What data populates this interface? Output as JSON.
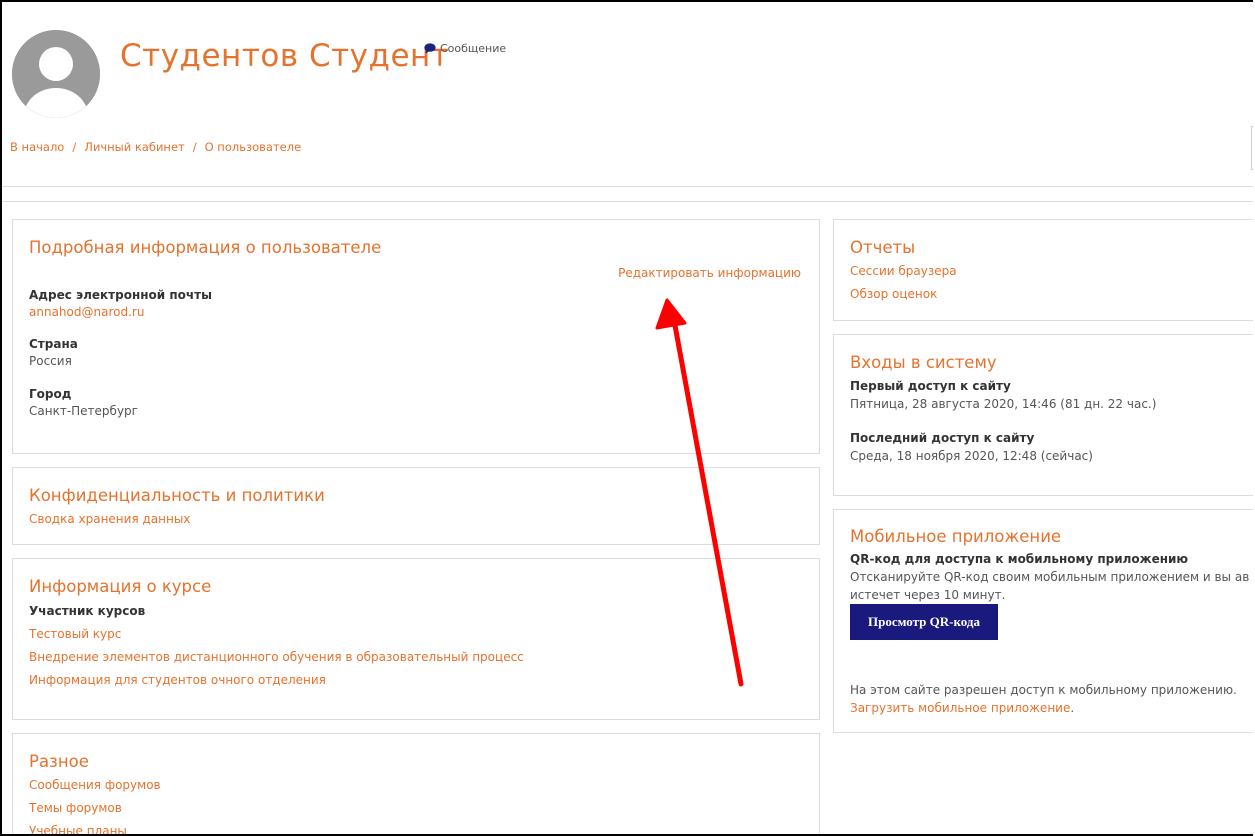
{
  "header": {
    "user_name": "Студентов Студент",
    "message_label": "Сообщение",
    "breadcrumb": [
      "В начало",
      "Личный кабинет",
      "О пользователе"
    ]
  },
  "user_details": {
    "title": "Подробная информация о пользователе",
    "edit_link": "Редактировать информацию",
    "email_label": "Адрес электронной почты",
    "email_value": "annahod@narod.ru",
    "country_label": "Страна",
    "country_value": "Россия",
    "city_label": "Город",
    "city_value": "Санкт-Петербург"
  },
  "privacy": {
    "title": "Конфиденциальность и политики",
    "link": "Сводка хранения данных"
  },
  "course_info": {
    "title": "Информация о курсе",
    "label": "Участник курсов",
    "courses": [
      "Тестовый курс",
      "Внедрение элементов дистанционного обучения в образовательный процесс",
      "Информация для студентов очного отделения"
    ]
  },
  "misc": {
    "title": "Разное",
    "links": [
      "Сообщения форумов",
      "Темы форумов",
      "Учебные планы"
    ]
  },
  "reports": {
    "title": "Отчеты",
    "links": [
      "Сессии браузера",
      "Обзор оценок"
    ]
  },
  "logins": {
    "title": "Входы в систему",
    "first_label": "Первый доступ к сайту",
    "first_value": "Пятница, 28 августа 2020, 14:46  (81 дн. 22 час.)",
    "last_label": "Последний доступ к сайту",
    "last_value": "Среда, 18 ноября 2020, 12:48  (сейчас)"
  },
  "mobile": {
    "title": "Мобильное приложение",
    "qr_label": "QR-код для доступа к мобильному приложению",
    "qr_text1": "Отсканируйте QR-код своим мобильным приложением и вы ав",
    "qr_text2": "истечет через 10 минут.",
    "qr_button": "Просмотр QR-кода",
    "access_text": "На этом сайте разрешен доступ к мобильному приложению.",
    "download_link": "Загрузить мобильное приложение",
    "download_suffix": "."
  },
  "colors": {
    "accent": "#e5722d",
    "button": "#1a1a7e",
    "arrow": "#ff0000"
  },
  "icons": {
    "avatar": "user-avatar-icon",
    "message": "speech-bubble-icon"
  }
}
